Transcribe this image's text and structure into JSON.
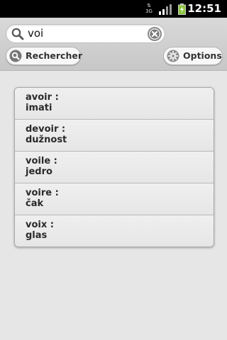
{
  "status_bar": {
    "network": "3G",
    "time": "12:51"
  },
  "search": {
    "value": "voi",
    "placeholder": ""
  },
  "toolbar": {
    "search_label": "Rechercher",
    "options_label": "Options"
  },
  "results": [
    {
      "word": "avoir :",
      "translation": "imati"
    },
    {
      "word": "devoir :",
      "translation": "dužnost"
    },
    {
      "word": "voile :",
      "translation": "jedro"
    },
    {
      "word": "voire :",
      "translation": "čak"
    },
    {
      "word": "voix :",
      "translation": "glas"
    }
  ],
  "colors": {
    "background": "#e6e6e6",
    "status_bar": "#000000",
    "battery_charge": "#8cc63f"
  }
}
